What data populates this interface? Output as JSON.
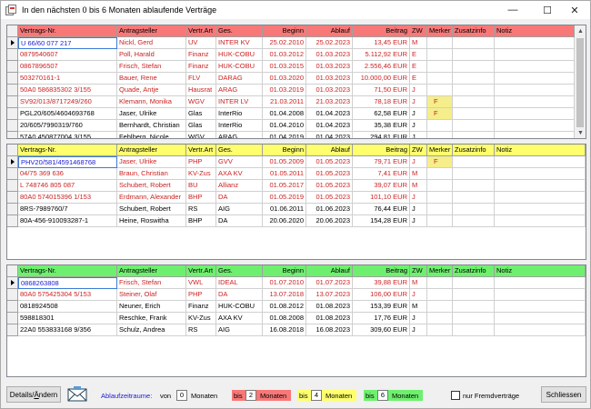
{
  "window": {
    "title": "In den nächsten 0 bis 6 Monaten ablaufende Verträge",
    "minimize": "—",
    "maximize": "☐",
    "close": "✕"
  },
  "colors": {
    "red_header": "#f87878",
    "yellow_header": "#ffff6e",
    "green_header": "#6ef06e",
    "row_text_red": "#cc2222",
    "merker_yellow": "#f5ee8a",
    "accent_blue": "#1a1ad6"
  },
  "columns": [
    "Vertrags-Nr.",
    "Antragsteller",
    "Vertr.Art",
    "Ges.",
    "Beginn",
    "Ablauf",
    "Beitrag",
    "ZW",
    "Merker",
    "Zusatzinfo",
    "Notiz"
  ],
  "grid_red": {
    "rows": [
      {
        "vnr": "U 66/60 077 217",
        "antr": "Nickl, Gerd",
        "art": "UV",
        "ges": "INTER KV",
        "beginn": "25.02.2010",
        "ablauf": "25.02.2023",
        "beitrag": "13,45 EUR",
        "zw": "M",
        "merker": "",
        "zusatz": "",
        "notiz": "",
        "red": true,
        "current": true
      },
      {
        "vnr": "0879540607",
        "antr": "Poll, Harald",
        "art": "Finanz",
        "ges": "HUK-COBU",
        "beginn": "01.03.2012",
        "ablauf": "01.03.2023",
        "beitrag": "5.112,92 EUR",
        "zw": "E",
        "merker": "",
        "zusatz": "",
        "notiz": "",
        "red": true
      },
      {
        "vnr": "0867896507",
        "antr": "Frisch, Stefan",
        "art": "Finanz",
        "ges": "HUK-COBU",
        "beginn": "01.03.2015",
        "ablauf": "01.03.2023",
        "beitrag": "2.556,46 EUR",
        "zw": "E",
        "merker": "",
        "zusatz": "",
        "notiz": "",
        "red": true
      },
      {
        "vnr": "503270161-1",
        "antr": "Bauer, Rene",
        "art": "FLV",
        "ges": "DARAG",
        "beginn": "01.03.2020",
        "ablauf": "01.03.2023",
        "beitrag": "10.000,00 EUR",
        "zw": "E",
        "merker": "",
        "zusatz": "",
        "notiz": "",
        "red": true
      },
      {
        "vnr": "50A0 586835302 3/155",
        "antr": "Quade, Antje",
        "art": "Hausrat",
        "ges": "ARAG",
        "beginn": "01.03.2019",
        "ablauf": "01.03.2023",
        "beitrag": "71,50 EUR",
        "zw": "J",
        "merker": "",
        "zusatz": "",
        "notiz": "",
        "red": true
      },
      {
        "vnr": "SV92/013/8717249/260",
        "antr": "Klemann, Monika",
        "art": "WGV",
        "ges": "INTER LV",
        "beginn": "21.03.2011",
        "ablauf": "21.03.2023",
        "beitrag": "78,18 EUR",
        "zw": "J",
        "merker": "F",
        "zusatz": "",
        "notiz": "",
        "red": true
      },
      {
        "vnr": "PGL20/605/4604693768",
        "antr": "Jaser, Ulrike",
        "art": "Glas",
        "ges": "InterRio",
        "beginn": "01.04.2008",
        "ablauf": "01.04.2023",
        "beitrag": "62,58 EUR",
        "zw": "J",
        "merker": "F",
        "zusatz": "",
        "notiz": "",
        "red": false
      },
      {
        "vnr": "20/605/7990319/760",
        "antr": "Bernhardt, Christian",
        "art": "Glas",
        "ges": "InterRio",
        "beginn": "01.04.2010",
        "ablauf": "01.04.2023",
        "beitrag": "35,38 EUR",
        "zw": "J",
        "merker": "",
        "zusatz": "",
        "notiz": "",
        "red": false
      },
      {
        "vnr": "57A0 450877004 3/155",
        "antr": "Fehlberg, Nicole",
        "art": "WGV",
        "ges": "ARAG",
        "beginn": "01.04.2019",
        "ablauf": "01.04.2023",
        "beitrag": "294,81 EUR",
        "zw": "J",
        "merker": "",
        "zusatz": "",
        "notiz": "",
        "red": false
      }
    ]
  },
  "grid_yellow": {
    "rows": [
      {
        "vnr": "PHV20/581/4591468768",
        "antr": "Jaser, Ulrike",
        "art": "PHP",
        "ges": "GVV",
        "beginn": "01.05.2009",
        "ablauf": "01.05.2023",
        "beitrag": "79,71 EUR",
        "zw": "J",
        "merker": "F",
        "zusatz": "",
        "notiz": "",
        "red": true,
        "current": true
      },
      {
        "vnr": "04/75 369 636",
        "antr": "Braun, Christian",
        "art": "KV-Zus",
        "ges": "AXA KV",
        "beginn": "01.05.2011",
        "ablauf": "01.05.2023",
        "beitrag": "7,41 EUR",
        "zw": "M",
        "merker": "",
        "zusatz": "",
        "notiz": "",
        "red": true
      },
      {
        "vnr": "L 748746 805 087",
        "antr": "Schubert, Robert",
        "art": "BU",
        "ges": "Allianz",
        "beginn": "01.05.2017",
        "ablauf": "01.05.2023",
        "beitrag": "39,07 EUR",
        "zw": "M",
        "merker": "",
        "zusatz": "",
        "notiz": "",
        "red": true
      },
      {
        "vnr": "80A0 574015396 1/153",
        "antr": "Erdmann, Alexander",
        "art": "BHP",
        "ges": "DA",
        "beginn": "01.05.2019",
        "ablauf": "01.05.2023",
        "beitrag": "101,10 EUR",
        "zw": "J",
        "merker": "",
        "zusatz": "",
        "notiz": "",
        "red": true
      },
      {
        "vnr": "8RS-7989760/7",
        "antr": "Schubert, Robert",
        "art": "RS",
        "ges": "AIG",
        "beginn": "01.06.2011",
        "ablauf": "01.06.2023",
        "beitrag": "76,44 EUR",
        "zw": "J",
        "merker": "",
        "zusatz": "",
        "notiz": "",
        "red": false
      },
      {
        "vnr": "80A-456-910093287-1",
        "antr": "Heine, Roswitha",
        "art": "BHP",
        "ges": "DA",
        "beginn": "20.06.2020",
        "ablauf": "20.06.2023",
        "beitrag": "154,28 EUR",
        "zw": "J",
        "merker": "",
        "zusatz": "",
        "notiz": "",
        "red": false
      }
    ]
  },
  "grid_green": {
    "rows": [
      {
        "vnr": "0868263808",
        "antr": "Frisch, Stefan",
        "art": "VWL",
        "ges": "IDEAL",
        "beginn": "01.07.2010",
        "ablauf": "01.07.2023",
        "beitrag": "39,88 EUR",
        "zw": "M",
        "merker": "",
        "zusatz": "",
        "notiz": "",
        "red": true,
        "current": true
      },
      {
        "vnr": "80A0 575425304 5/153",
        "antr": "Steiner, Olaf",
        "art": "PHP",
        "ges": "DA",
        "beginn": "13.07.2018",
        "ablauf": "13.07.2023",
        "beitrag": "106,00 EUR",
        "zw": "J",
        "merker": "",
        "zusatz": "",
        "notiz": "",
        "red": true
      },
      {
        "vnr": "0818924508",
        "antr": "Neuner, Erich",
        "art": "Finanz",
        "ges": "HUK-COBU",
        "beginn": "01.08.2012",
        "ablauf": "01.08.2023",
        "beitrag": "153,39 EUR",
        "zw": "M",
        "merker": "",
        "zusatz": "",
        "notiz": "",
        "red": false
      },
      {
        "vnr": "598818301",
        "antr": "Reschke, Frank",
        "art": "KV-Zus",
        "ges": "AXA KV",
        "beginn": "01.08.2008",
        "ablauf": "01.08.2023",
        "beitrag": "17,76 EUR",
        "zw": "J",
        "merker": "",
        "zusatz": "",
        "notiz": "",
        "red": false
      },
      {
        "vnr": "22A0 553833168 9/356",
        "antr": "Schulz, Andrea",
        "art": "RS",
        "ges": "AIG",
        "beginn": "16.08.2018",
        "ablauf": "16.08.2023",
        "beitrag": "309,60 EUR",
        "zw": "J",
        "merker": "",
        "zusatz": "",
        "notiz": "",
        "red": false
      }
    ]
  },
  "bottom": {
    "details_button": "Details/Ändern",
    "details_underline": "Ä",
    "ablauf_label": "Ablaufzeitraume:",
    "von_label": "von",
    "von_value": "0",
    "monaten_label": "Monaten",
    "bis_label": "bis",
    "bis1_value": "2",
    "bis2_value": "4",
    "bis3_value": "6",
    "fremd_label": "nur Fremdverträge",
    "close_button": "Schliessen"
  }
}
